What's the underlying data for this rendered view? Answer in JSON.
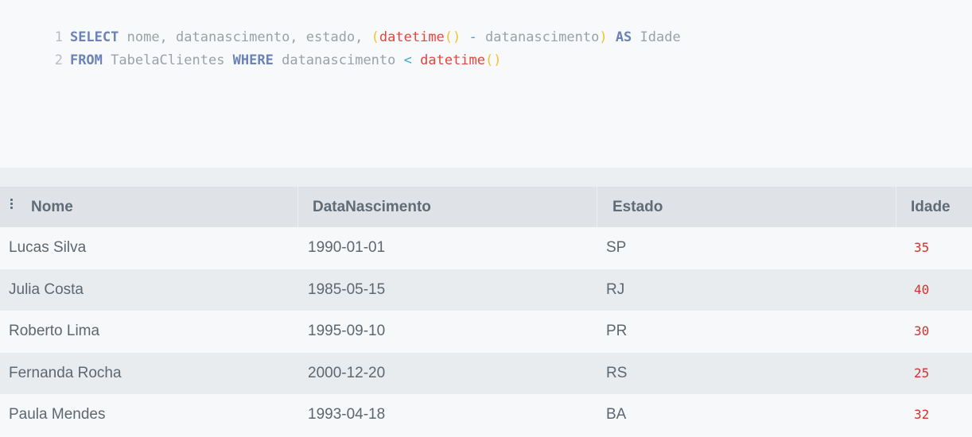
{
  "editor": {
    "lines": [
      {
        "number": "1",
        "tokens": [
          {
            "text": "SELECT",
            "cls": "kw"
          },
          {
            "text": " nome, datanascimento, estado, ",
            "cls": "id"
          },
          {
            "text": "(",
            "cls": "paren"
          },
          {
            "text": "datetime",
            "cls": "fn"
          },
          {
            "text": "()",
            "cls": "paren"
          },
          {
            "text": " ",
            "cls": "id"
          },
          {
            "text": "-",
            "cls": "op"
          },
          {
            "text": " datanascimento",
            "cls": "id"
          },
          {
            "text": ")",
            "cls": "paren"
          },
          {
            "text": " ",
            "cls": "id"
          },
          {
            "text": "AS",
            "cls": "kw"
          },
          {
            "text": " Idade",
            "cls": "id"
          }
        ]
      },
      {
        "number": "2",
        "tokens": [
          {
            "text": "FROM",
            "cls": "kw"
          },
          {
            "text": " TabelaClientes ",
            "cls": "id"
          },
          {
            "text": "WHERE",
            "cls": "kw"
          },
          {
            "text": " datanascimento ",
            "cls": "id"
          },
          {
            "text": "<",
            "cls": "op"
          },
          {
            "text": " ",
            "cls": "id"
          },
          {
            "text": "datetime",
            "cls": "fn"
          },
          {
            "text": "()",
            "cls": "paren"
          }
        ]
      }
    ]
  },
  "results": {
    "menu_icon": "vertical-dots-icon",
    "columns": [
      "Nome",
      "DataNascimento",
      "Estado",
      "Idade"
    ],
    "rows": [
      [
        "Lucas Silva",
        "1990-01-01",
        "SP",
        "35"
      ],
      [
        "Julia Costa",
        "1985-05-15",
        "RJ",
        "40"
      ],
      [
        "Roberto Lima",
        "1995-09-10",
        "PR",
        "30"
      ],
      [
        "Fernanda Rocha",
        "2000-12-20",
        "RS",
        "25"
      ],
      [
        "Paula Mendes",
        "1993-04-18",
        "BA",
        "32"
      ]
    ]
  },
  "colors": {
    "keyword": "#6a82b8",
    "function": "#e2463d",
    "paren": "#f2c22e",
    "operator": "#41a7cc",
    "identifier": "#9aa1a8",
    "number": "#d0312d"
  }
}
